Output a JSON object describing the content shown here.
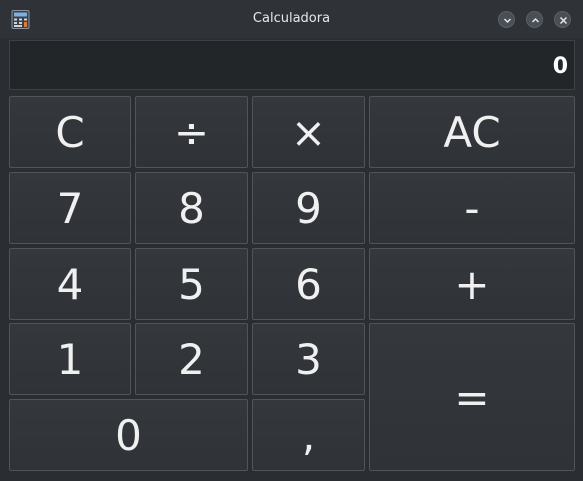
{
  "window": {
    "title": "Calculadora",
    "icon": "calculator-icon",
    "controls": [
      "minimize-icon",
      "maximize-icon",
      "close-icon"
    ]
  },
  "display": {
    "value": "0"
  },
  "keys": {
    "clear": "C",
    "divide": "÷",
    "multiply": "×",
    "all_clear": "AC",
    "seven": "7",
    "eight": "8",
    "nine": "9",
    "minus": "-",
    "four": "4",
    "five": "5",
    "six": "6",
    "plus": "+",
    "one": "1",
    "two": "2",
    "three": "3",
    "equals": "=",
    "zero": "0",
    "comma": ","
  }
}
